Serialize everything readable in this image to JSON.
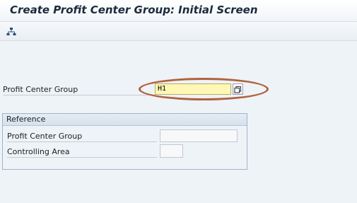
{
  "header": {
    "title": "Create Profit Center Group: Initial Screen"
  },
  "toolbar": {
    "hierarchy_icon": "hierarchy-icon"
  },
  "main": {
    "profit_center_group_label": "Profit Center Group",
    "profit_center_group_value": "H1",
    "value_help_icon": "value-help-icon"
  },
  "reference": {
    "title": "Reference",
    "profit_center_group_label": "Profit Center Group",
    "profit_center_group_value": "",
    "controlling_area_label": "Controlling Area",
    "controlling_area_value": ""
  },
  "colors": {
    "highlight_annotation": "#b0623e",
    "required_field_bg": "#fff7b5"
  }
}
